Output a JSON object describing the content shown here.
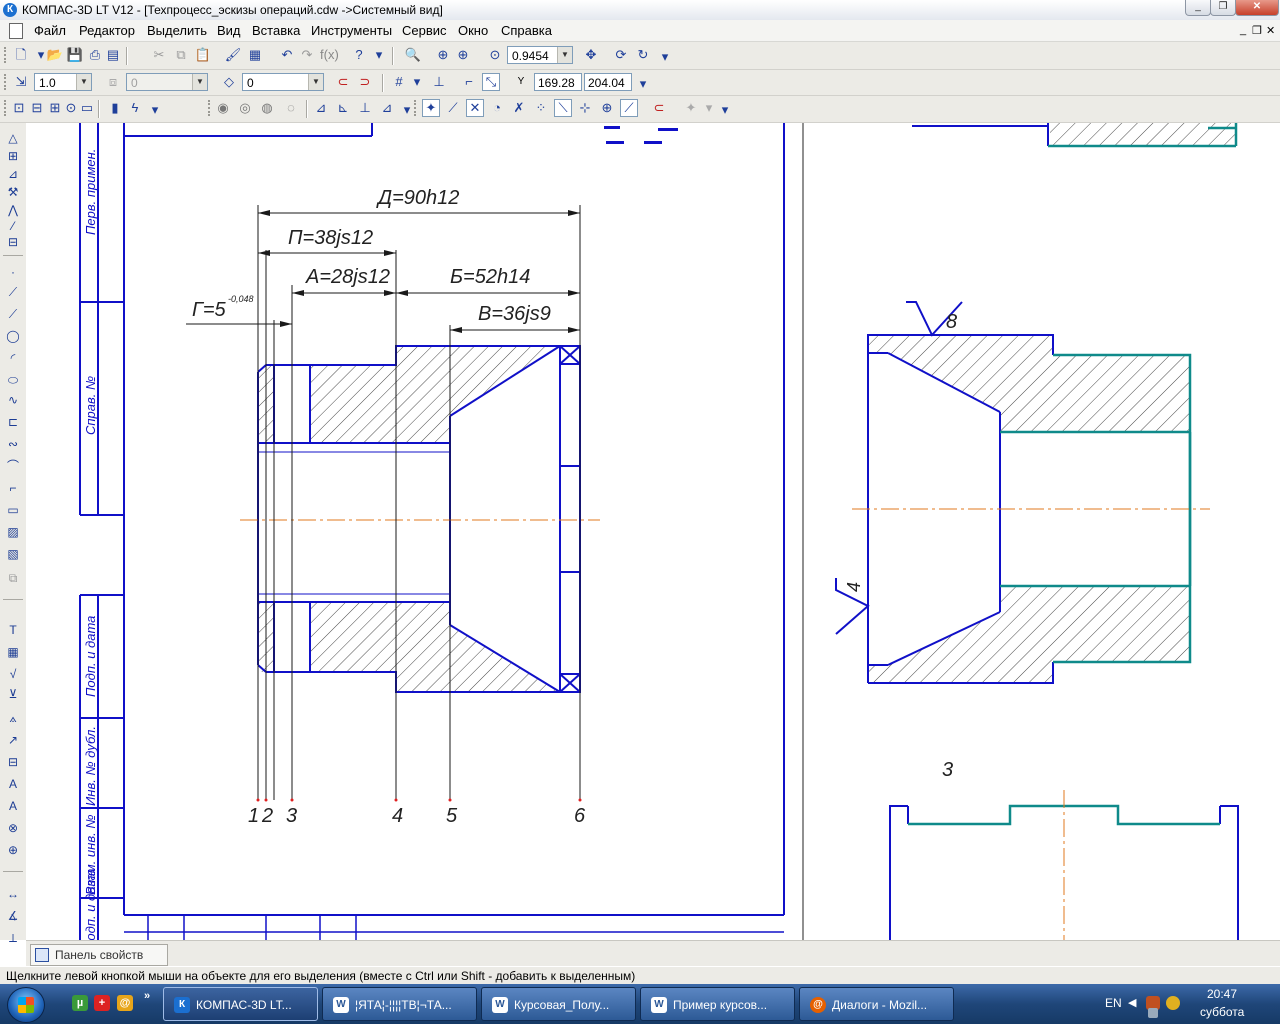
{
  "window": {
    "title": "КОМПАС-3D LT V12 - [Техпроцесс_эскизы операций.cdw ->Системный вид]",
    "app_icon": "К"
  },
  "menu": {
    "items": [
      "Файл",
      "Редактор",
      "Выделить",
      "Вид",
      "Вставка",
      "Инструменты",
      "Сервис",
      "Окно",
      "Справка"
    ]
  },
  "toolbar": {
    "zoom_value": "0.9454",
    "line_step": "1.0",
    "angle_step": "0",
    "layer": "0",
    "coord_x": "169.28",
    "coord_y": "204.04",
    "coord_label": "Y"
  },
  "drawing": {
    "side_labels": [
      "Перв. примен.",
      "Справ. №",
      "Подп. и дата",
      "Инв. № дубл.",
      "Взам. инв. №",
      "Подп. и дата"
    ],
    "dimensions": {
      "d": "Д=90h12",
      "p": "П=38js12",
      "a": "А=28js12",
      "b": "Б=52h14",
      "v": "В=36js9",
      "g": "Г=5",
      "g_tol": "-0,048"
    },
    "surface_numbers": [
      "1",
      "2",
      "3",
      "4",
      "5",
      "6"
    ],
    "roughness_top": "8",
    "roughness_left": "4",
    "view_number": "3"
  },
  "property_panel": {
    "tab_label": "Панель свойств"
  },
  "status": {
    "message": "Щелкните левой кнопкой мыши на объекте для его выделения (вместе с Ctrl или Shift - добавить к выделенным)"
  },
  "taskbar": {
    "buttons": [
      {
        "label": "КОМПАС-3D LT...",
        "icon": "К",
        "color": "#1b6fd0"
      },
      {
        "label": "¦ЯТА¦-¦¦¦¦ТВ¦¬ТА...",
        "icon": "W",
        "color": "#2b5797"
      },
      {
        "label": "Курсовая_Полу...",
        "icon": "W",
        "color": "#2b5797"
      },
      {
        "label": "Пример курсов...",
        "icon": "W",
        "color": "#2b5797"
      },
      {
        "label": "Диалоги - Mozil...",
        "icon": "@",
        "color": "#e66000"
      }
    ],
    "lang": "EN",
    "time": "20:47",
    "day": "суббота"
  }
}
